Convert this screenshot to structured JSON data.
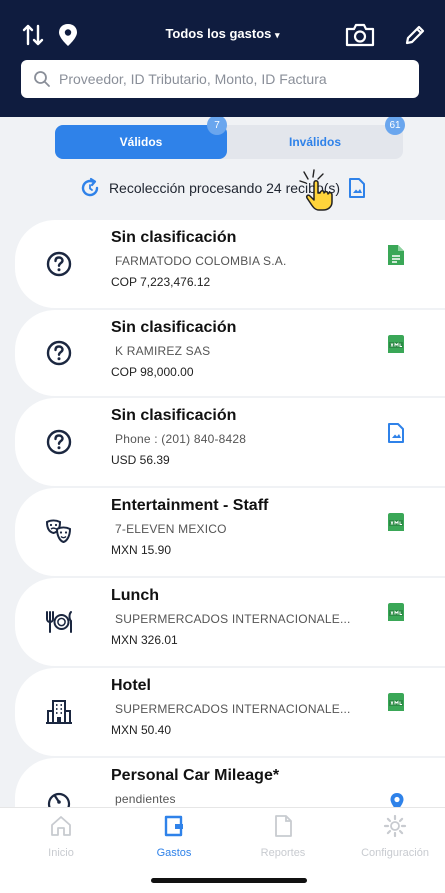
{
  "header": {
    "title": "Todos los gastos",
    "search_placeholder": "Proveedor, ID Tributario, Monto, ID Factura"
  },
  "tabs": {
    "valid": {
      "label": "Válidos",
      "count": "7"
    },
    "invalid": {
      "label": "Inválidos",
      "count": "61"
    }
  },
  "processing": {
    "text": "Recolección procesando 24 recibo(s)"
  },
  "expenses": [
    {
      "title": "Sin clasificación",
      "vendor": "FARMATODO COLOMBIA S.A.",
      "amount": "COP 7,223,476.12",
      "icon": "question-icon",
      "doc": "green-doc-icon"
    },
    {
      "title": "Sin clasificación",
      "vendor": "K RAMIREZ SAS",
      "amount": "COP 98,000.00",
      "icon": "question-icon",
      "doc": "xml-icon"
    },
    {
      "title": "Sin clasificación",
      "vendor": "Phone : (201) 840-8428",
      "amount": "USD 56.39",
      "icon": "question-icon",
      "doc": "blue-doc-icon"
    },
    {
      "title": "Entertainment - Staff",
      "vendor": "7-ELEVEN MEXICO",
      "amount": "MXN 15.90",
      "icon": "masks-icon",
      "doc": "xml-icon"
    },
    {
      "title": "Lunch",
      "vendor": "SUPERMERCADOS INTERNACIONALE...",
      "amount": "MXN 326.01",
      "icon": "utensils-icon",
      "doc": "xml-icon"
    },
    {
      "title": "Hotel",
      "vendor": "SUPERMERCADOS INTERNACIONALE...",
      "amount": "MXN 50.40",
      "icon": "building-icon",
      "doc": "xml-icon"
    },
    {
      "title": "Personal Car Mileage*",
      "vendor": "pendientes",
      "amount": "",
      "icon": "gauge-icon",
      "doc": "location-pin-icon"
    }
  ],
  "nav": [
    {
      "label": "Inicio"
    },
    {
      "label": "Gastos"
    },
    {
      "label": "Reportes"
    },
    {
      "label": "Configuración"
    }
  ],
  "colors": {
    "header_bg": "#0f1c3f",
    "accent": "#2f82e9",
    "list_bg": "#f0f2f5",
    "xml_green": "#3aa757"
  }
}
